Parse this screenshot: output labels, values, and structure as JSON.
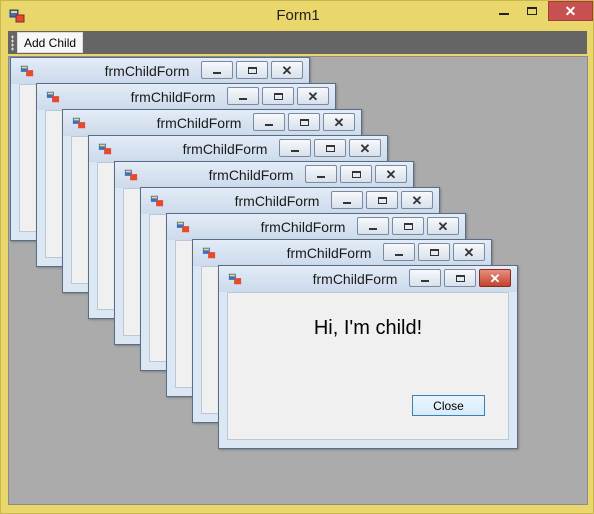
{
  "window": {
    "title": "Form1"
  },
  "menu": {
    "add_child_label": "Add Child"
  },
  "children": {
    "title": "frmChildForm",
    "greeting": "Hi, I'm child!",
    "close_label": "Close"
  },
  "icons": {
    "app": "app-icon",
    "minimize": "minimize-icon",
    "maximize": "maximize-icon",
    "close": "close-icon"
  },
  "colors": {
    "frame": "#e9d76c",
    "mdi_background": "#ababab",
    "close_active": "#c75050"
  }
}
